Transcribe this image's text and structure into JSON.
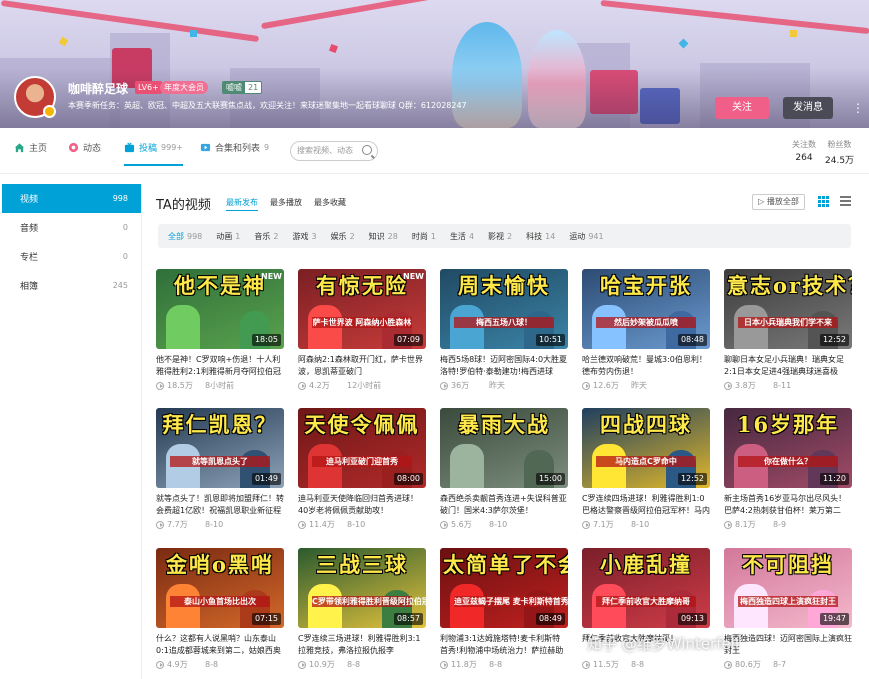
{
  "profile": {
    "name": "咖啡醉足球",
    "level": "LV6+",
    "vip": "年度大会员",
    "medal_name": "嘘嘘",
    "medal_level": "21",
    "signature": "本赛季新任务：英超、欧冠、中超及五大联赛焦点战，欢迎关注！来球迷聚集地一起看球聊球 Q群：612028247",
    "follow_label": "关注",
    "message_label": "发消息"
  },
  "nav": {
    "items": [
      {
        "label": "主页",
        "count": ""
      },
      {
        "label": "动态",
        "count": ""
      },
      {
        "label": "投稿",
        "count": "999+"
      },
      {
        "label": "合集和列表",
        "count": "9"
      }
    ],
    "search_placeholder": "搜索视频、动态",
    "stats": [
      {
        "label": "关注数",
        "value": "264"
      },
      {
        "label": "粉丝数",
        "value": "24.5万"
      }
    ]
  },
  "sidebar": {
    "items": [
      {
        "label": "视频",
        "count": "998"
      },
      {
        "label": "音频",
        "count": "0"
      },
      {
        "label": "专栏",
        "count": "0"
      },
      {
        "label": "相簿",
        "count": "245"
      }
    ]
  },
  "main": {
    "heading": "TA的视频",
    "sorts": [
      "最新发布",
      "最多播放",
      "最多收藏"
    ],
    "play_all": "播放全部",
    "tags": [
      {
        "label": "全部",
        "count": "998"
      },
      {
        "label": "动画",
        "count": "1"
      },
      {
        "label": "音乐",
        "count": "2"
      },
      {
        "label": "游戏",
        "count": "3"
      },
      {
        "label": "娱乐",
        "count": "2"
      },
      {
        "label": "知识",
        "count": "28"
      },
      {
        "label": "时尚",
        "count": "1"
      },
      {
        "label": "生活",
        "count": "4"
      },
      {
        "label": "影视",
        "count": "2"
      },
      {
        "label": "科技",
        "count": "14"
      },
      {
        "label": "运动",
        "count": "941"
      }
    ]
  },
  "videos": [
    {
      "thumb_title": "他不是神",
      "thumb_sub": "",
      "badge": "NEW",
      "duration": "18:05",
      "title": "他不是神！C罗双响+伤退！十人利雅得胜利2:1利雅得新月夺阿拉伯冠军",
      "plays": "18.5万",
      "date": "8小时前",
      "colors": [
        "#2f6f3a",
        "#5aa24d"
      ]
    },
    {
      "thumb_title": "有惊无险",
      "thumb_sub": "萨卡世界波 阿森纳小胜森林",
      "badge": "NEW",
      "duration": "07:09",
      "title": "阿森纳2:1森林取开门红，萨卡世界波，恩凯蒂亚破门",
      "plays": "4.2万",
      "date": "12小时前",
      "colors": [
        "#7a1f24",
        "#c83c3a"
      ]
    },
    {
      "thumb_title": "周末愉快",
      "thumb_sub": "梅西五场八球！",
      "badge": "",
      "duration": "10:51",
      "title": "梅西5场8球！迈阿密国际4:0大胜夏洛特!罗伯特·泰勒建功!梅西进球",
      "plays": "36万",
      "date": "昨天",
      "colors": [
        "#204a63",
        "#3b84a8"
      ]
    },
    {
      "thumb_title": "哈宝开张",
      "thumb_sub": "然后妙架被瓜瓜喷",
      "badge": "",
      "duration": "08:48",
      "title": "哈兰德双响破荒！曼城3:0伯恩利！德布劳内伤退！",
      "plays": "12.6万",
      "date": "昨天",
      "colors": [
        "#2d4b73",
        "#6a9bd0"
      ]
    },
    {
      "thumb_title": "意志or技术？",
      "thumb_sub": "日本小兵瑞典我们学不来",
      "badge": "",
      "duration": "12:52",
      "title": "聊聊日本女足小兵瑞典！瑞典女足2:1日本女足进4强瑞典球迷喜极泣！",
      "plays": "3.8万",
      "date": "8-11",
      "colors": [
        "#3c3c3c",
        "#7a7a7a"
      ]
    },
    {
      "thumb_title": "拜仁凯恩？",
      "thumb_sub": "就等凯恩点头了",
      "badge": "",
      "duration": "01:49",
      "title": "就等点头了！凯恩即将加盟拜仁！转会费超1亿欧！祝福凯恩职业新征程",
      "plays": "7.7万",
      "date": "8-10",
      "colors": [
        "#233a52",
        "#8ea3b8"
      ]
    },
    {
      "thumb_title": "天使令佩佩",
      "thumb_sub": "迪马利亚破门迎首秀",
      "badge": "",
      "duration": "08:00",
      "title": "迪马利亚天使降临回归首秀进球！40岁老将佩佩贡献助攻！",
      "plays": "11.4万",
      "date": "8-10",
      "colors": [
        "#6e1717",
        "#b22a2a"
      ]
    },
    {
      "thumb_title": "暴雨大战",
      "thumb_sub": "",
      "badge": "",
      "duration": "15:00",
      "title": "森西绝杀卖靓首秀连进+失误科普亚破门！国米4:3萨尔茨堡！",
      "plays": "5.6万",
      "date": "8-10",
      "colors": [
        "#3a4a3c",
        "#7d8f7e"
      ]
    },
    {
      "thumb_title": "四战四球",
      "thumb_sub": "马内造点C罗命中",
      "badge": "",
      "duration": "12:52",
      "title": "C罗连续四场进球！利雅得胜利1:0巴格达警察晋级阿拉伯冠军杯！马内造点",
      "plays": "7.1万",
      "date": "8-10",
      "colors": [
        "#1f3f5f",
        "#e1b82a"
      ]
    },
    {
      "thumb_title": "16岁那年",
      "thumb_sub": "你在做什么？",
      "badge": "",
      "duration": "11:20",
      "title": "新主场首秀16岁亚马尔出尽风头！巴萨4:2热刺获甘伯杯！莱万第二",
      "plays": "8.1万",
      "date": "8-9",
      "colors": [
        "#45283f",
        "#a24b67"
      ]
    },
    {
      "thumb_title": "金哨o黑哨",
      "thumb_sub": "泰山小鱼首场比出次",
      "badge": "",
      "duration": "07:15",
      "title": "什么？这都有人说黑哨？山东泰山0:1追成都蓉城来到第二，姑娘西奥",
      "plays": "4.9万",
      "date": "8-8",
      "colors": [
        "#7a2a12",
        "#d4692a"
      ]
    },
    {
      "thumb_title": "三战三球",
      "thumb_sub": "C罗带领利雅得胜利晋级阿拉伯冠军杯",
      "badge": "",
      "duration": "08:57",
      "title": "C罗连续三场进球！利雅得胜利3:1拉雅竞技，弗洛拉报仇报李",
      "plays": "10.9万",
      "date": "8-8",
      "colors": [
        "#2b5a2f",
        "#e2c23c"
      ]
    },
    {
      "thumb_title": "太简单了不会",
      "thumb_sub": "迪亚兹蝎子摆尾 麦卡利斯特首秀",
      "badge": "",
      "duration": "08:49",
      "title": "利物浦3:1达姆施塔特!麦卡利斯特首秀!利物浦中场统治力！萨拉赫助攻进球",
      "plays": "11.8万",
      "date": "8-8",
      "colors": [
        "#6a1010",
        "#c02020"
      ]
    },
    {
      "thumb_title": "小鹿乱撞",
      "thumb_sub": "拜仁季前收官大胜摩纳哥",
      "badge": "",
      "duration": "09:13",
      "title": "拜仁季前收官大胜摩纳哥！",
      "plays": "11.5万",
      "date": "8-8",
      "colors": [
        "#7a1f2a",
        "#cf3c48"
      ]
    },
    {
      "thumb_title": "不可阻挡",
      "thumb_sub": "梅西独造四球上演疯狂封王",
      "badge": "",
      "duration": "19:47",
      "title": "梅西独造四球！迈阿密国际上演疯狂封王",
      "plays": "80.6万",
      "date": "8-7",
      "colors": [
        "#d2789a",
        "#f4b8cc"
      ]
    }
  ],
  "watermark": "知乎 @维罗Winterfell"
}
